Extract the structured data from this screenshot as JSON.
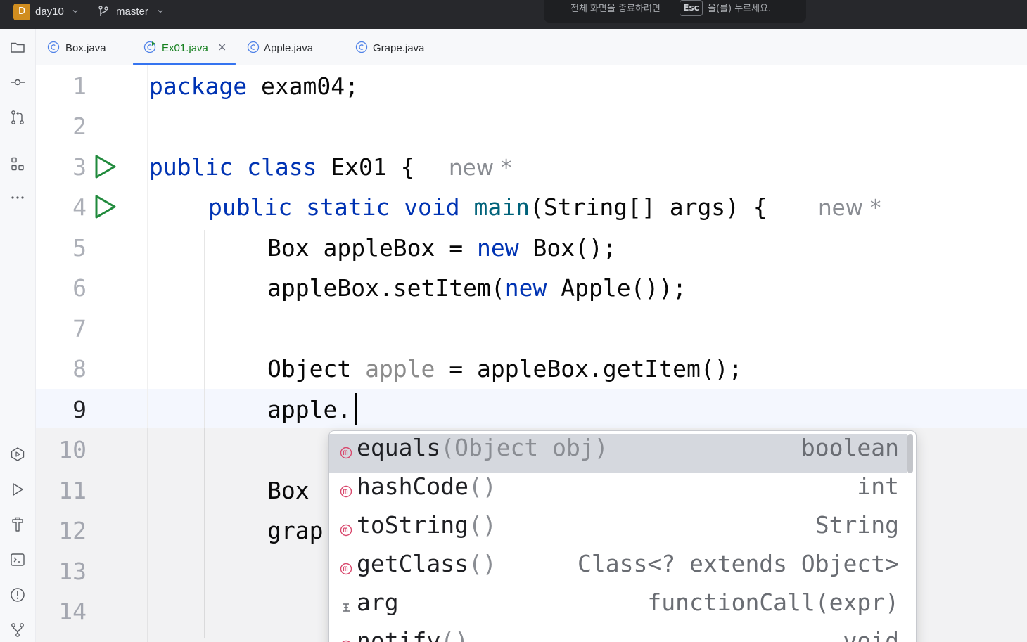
{
  "titlebar": {
    "project_badge": "D",
    "project_name": "day10",
    "branch": "master",
    "fullscreen_hint_before": "전체 화면을 종료하려면",
    "fullscreen_hint_key": "Esc",
    "fullscreen_hint_after": "을(를) 누르세요."
  },
  "toolstrip": {
    "top": [
      "folder-icon",
      "commit-icon",
      "pull-request-icon",
      "structure-icon",
      "more-icon"
    ],
    "bottom": [
      "services-icon",
      "run-icon",
      "build-icon",
      "terminal-icon",
      "problems-icon",
      "git-icon"
    ]
  },
  "tabs": [
    {
      "label": "Box.java",
      "active": false,
      "closable": false
    },
    {
      "label": "Ex01.java",
      "active": true,
      "closable": true,
      "close_glyph": "×"
    },
    {
      "label": "Apple.java",
      "active": false,
      "closable": false
    },
    {
      "label": "Grape.java",
      "active": false,
      "closable": false
    }
  ],
  "editor": {
    "line_numbers": [
      "1",
      "2",
      "3",
      "4",
      "5",
      "6",
      "7",
      "8",
      "9",
      "10",
      "11",
      "12",
      "13",
      "14"
    ],
    "current_line": "9",
    "lines": {
      "l1": {
        "kw1": "package",
        "rest": " exam04;"
      },
      "l3": {
        "kw1": "public",
        "kw2": "class",
        "rest": " Ex01 {",
        "hint": "new *"
      },
      "l4": {
        "kw1": "public",
        "kw2": "static",
        "kw3": "void",
        "fn": "main",
        "rest": "(String[] args) {",
        "hint": "new *"
      },
      "l5": {
        "pre": "Box appleBox = ",
        "kw": "new",
        "post": " Box();"
      },
      "l6": {
        "pre": "appleBox.setItem(",
        "kw": "new",
        "post": " Apple());"
      },
      "l8": {
        "pre": "Object ",
        "dim": "apple",
        "post": " = appleBox.getItem();"
      },
      "l9": {
        "text": "apple."
      },
      "l11": {
        "text": "Box"
      },
      "l12": {
        "text": "grap"
      }
    },
    "completion": {
      "items": [
        {
          "name": "equals",
          "params": "(Object obj)",
          "type": "boolean",
          "icon": "method-icon",
          "selected": true
        },
        {
          "name": "hashCode",
          "params": "()",
          "type": "int",
          "icon": "method-icon",
          "selected": false
        },
        {
          "name": "toString",
          "params": "()",
          "type": "String",
          "icon": "method-icon",
          "selected": false
        },
        {
          "name": "getClass",
          "params": "()",
          "type": "Class<? extends Object>",
          "icon": "method-icon",
          "selected": false
        },
        {
          "name": "arg",
          "params": "",
          "type": "functionCall(expr)",
          "icon": "postfix-template-icon",
          "selected": false
        },
        {
          "name": "notify",
          "params": "()",
          "type": "void",
          "icon": "method-icon",
          "selected": false
        }
      ]
    }
  },
  "colors": {
    "keyword": "#0033b3",
    "method_declaration": "#00627a",
    "run_gutter": "#208a3c",
    "active_tab_text": "#16801f",
    "active_tab_underline": "#3574f0",
    "method_icon": "#d9486d"
  }
}
